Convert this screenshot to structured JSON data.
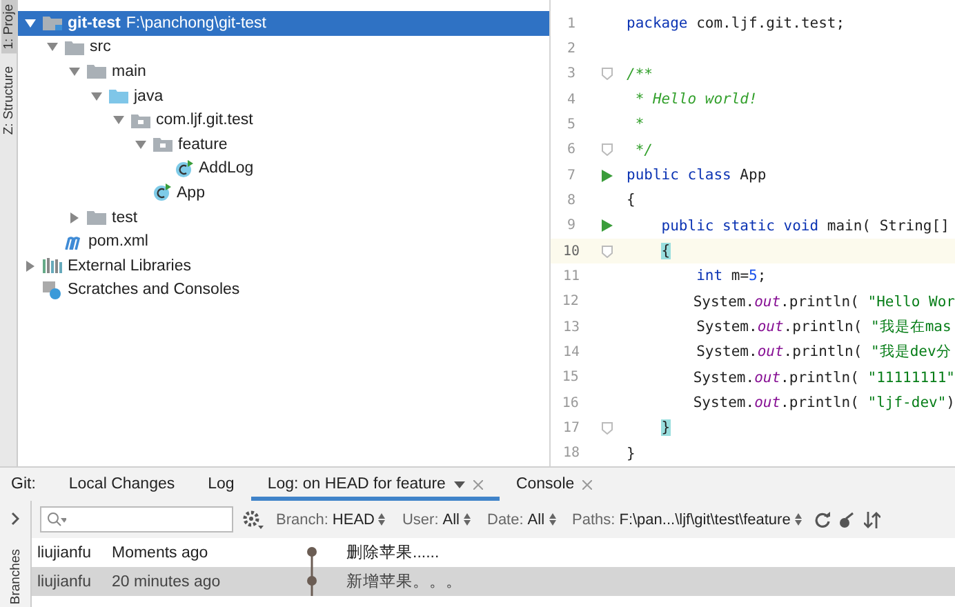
{
  "side_stripe": {
    "tabs": [
      {
        "label": "1: Proje",
        "selected": true
      },
      {
        "label": "Z: Structure",
        "selected": false
      }
    ]
  },
  "project_tree": {
    "items": [
      {
        "label": "git-test",
        "detail": "F:\\panchong\\git-test",
        "kind": "module",
        "expanded": true,
        "selected": true,
        "children": [
          {
            "label": "src",
            "kind": "folder",
            "expanded": true,
            "selected": false,
            "children": [
              {
                "label": "main",
                "kind": "folder",
                "expanded": true,
                "selected": false,
                "children": [
                  {
                    "label": "java",
                    "kind": "source",
                    "expanded": true,
                    "selected": false,
                    "children": [
                      {
                        "label": "com.ljf.git.test",
                        "kind": "package",
                        "expanded": true,
                        "selected": false,
                        "children": [
                          {
                            "label": "feature",
                            "kind": "package",
                            "expanded": true,
                            "selected": false,
                            "children": [
                              {
                                "label": "AddLog",
                                "kind": "class",
                                "selected": false
                              }
                            ]
                          },
                          {
                            "label": "App",
                            "kind": "class",
                            "selected": false
                          }
                        ]
                      }
                    ]
                  }
                ]
              },
              {
                "label": "test",
                "kind": "folder",
                "expanded": false,
                "selected": false
              }
            ]
          },
          {
            "label": "pom.xml",
            "kind": "maven",
            "selected": false
          }
        ]
      },
      {
        "label": "External Libraries",
        "kind": "libraries",
        "expanded": false,
        "selected": false
      },
      {
        "label": "Scratches and Consoles",
        "kind": "scratches",
        "selected": false
      }
    ]
  },
  "editor": {
    "lines": [
      {
        "number": "1",
        "kind": "plain",
        "current": false,
        "tokens": [
          {
            "kind": "keyword",
            "text": "package"
          },
          {
            "kind": "plain",
            "text": " com.ljf.git.test;"
          }
        ]
      },
      {
        "number": "2",
        "kind": "plain",
        "current": false
      },
      {
        "number": "3",
        "kind": "fold",
        "current": false,
        "tokens": [
          {
            "kind": "comment",
            "text": "/**"
          }
        ]
      },
      {
        "number": "4",
        "kind": "plain",
        "current": false,
        "tokens": [
          {
            "kind": "comment",
            "text": " * Hello world!"
          }
        ]
      },
      {
        "number": "5",
        "kind": "plain",
        "current": false,
        "tokens": [
          {
            "kind": "comment",
            "text": " *"
          }
        ]
      },
      {
        "number": "6",
        "kind": "fold",
        "current": false,
        "tokens": [
          {
            "kind": "comment",
            "text": " */"
          }
        ]
      },
      {
        "number": "7",
        "kind": "run",
        "current": false,
        "tokens": [
          {
            "kind": "keyword",
            "text": "public class"
          },
          {
            "kind": "plain",
            "text": " App"
          }
        ]
      },
      {
        "number": "8",
        "kind": "plain",
        "current": false,
        "tokens": [
          {
            "kind": "plain",
            "text": "{"
          }
        ]
      },
      {
        "number": "9",
        "kind": "run",
        "current": false,
        "tokens": [
          {
            "kind": "keyword",
            "text": "    public static void"
          },
          {
            "kind": "plain",
            "text": " main( String[]"
          }
        ]
      },
      {
        "number": "10",
        "kind": "fold",
        "current": true,
        "tokens": [
          {
            "kind": "brace",
            "text": "{"
          }
        ]
      },
      {
        "number": "11",
        "kind": "plain",
        "current": false,
        "tokens": [
          {
            "kind": "keyword",
            "text": "        int"
          },
          {
            "kind": "plain",
            "text": " m="
          },
          {
            "kind": "number",
            "text": "5"
          },
          {
            "kind": "plain",
            "text": ";"
          }
        ]
      },
      {
        "number": "12",
        "kind": "plain",
        "current": false,
        "tokens": [
          {
            "kind": "plain",
            "text": "        System."
          },
          {
            "kind": "field",
            "text": "out"
          },
          {
            "kind": "plain",
            "text": ".println( "
          },
          {
            "kind": "string",
            "text": "\"Hello Wor"
          }
        ]
      },
      {
        "number": "13",
        "kind": "plain",
        "current": false,
        "tokens": [
          {
            "kind": "plain",
            "text": "        System."
          },
          {
            "kind": "field",
            "text": "out"
          },
          {
            "kind": "plain",
            "text": ".println( "
          },
          {
            "kind": "string",
            "text": "\"我是在mas"
          }
        ]
      },
      {
        "number": "14",
        "kind": "plain",
        "current": false,
        "tokens": [
          {
            "kind": "plain",
            "text": "        System."
          },
          {
            "kind": "field",
            "text": "out"
          },
          {
            "kind": "plain",
            "text": ".println( "
          },
          {
            "kind": "string",
            "text": "\"我是dev分"
          }
        ]
      },
      {
        "number": "15",
        "kind": "plain",
        "current": false,
        "tokens": [
          {
            "kind": "plain",
            "text": "        System."
          },
          {
            "kind": "field",
            "text": "out"
          },
          {
            "kind": "plain",
            "text": ".println( "
          },
          {
            "kind": "string",
            "text": "\"11111111\""
          }
        ]
      },
      {
        "number": "16",
        "kind": "plain",
        "current": false,
        "tokens": [
          {
            "kind": "plain",
            "text": "        System."
          },
          {
            "kind": "field",
            "text": "out"
          },
          {
            "kind": "plain",
            "text": ".println( "
          },
          {
            "kind": "string",
            "text": "\"ljf-dev\""
          },
          {
            "kind": "plain",
            "text": ")"
          }
        ]
      },
      {
        "number": "17",
        "kind": "fold",
        "current": false,
        "tokens": [
          {
            "kind": "brace",
            "text": "}"
          }
        ]
      },
      {
        "number": "18",
        "kind": "plain",
        "current": false,
        "tokens": [
          {
            "kind": "plain",
            "text": "}"
          }
        ]
      }
    ]
  },
  "git_panel": {
    "label": "Git:",
    "tabs": [
      {
        "label": "Local Changes",
        "selected": false,
        "dropdown": false,
        "closable": false
      },
      {
        "label": "Log",
        "selected": false,
        "dropdown": false,
        "closable": false
      },
      {
        "label": "Log: on HEAD for feature",
        "selected": true,
        "dropdown": true,
        "closable": true
      },
      {
        "label": "Console",
        "selected": false,
        "dropdown": false,
        "closable": true
      }
    ],
    "side_tab": "Branches",
    "filters": [
      {
        "name": "Branch:",
        "value": "HEAD"
      },
      {
        "name": "User:",
        "value": "All"
      },
      {
        "name": "Date:",
        "value": "All"
      },
      {
        "name": "Paths:",
        "value": "F:\\pan...\\ljf\\git\\test\\feature"
      }
    ],
    "commits": [
      {
        "author": "liujianfu",
        "time": "Moments ago",
        "message": "删除苹果......",
        "selected": false
      },
      {
        "author": "liujianfu",
        "time": "20 minutes ago",
        "message": "新增苹果。。。",
        "selected": true
      }
    ]
  }
}
